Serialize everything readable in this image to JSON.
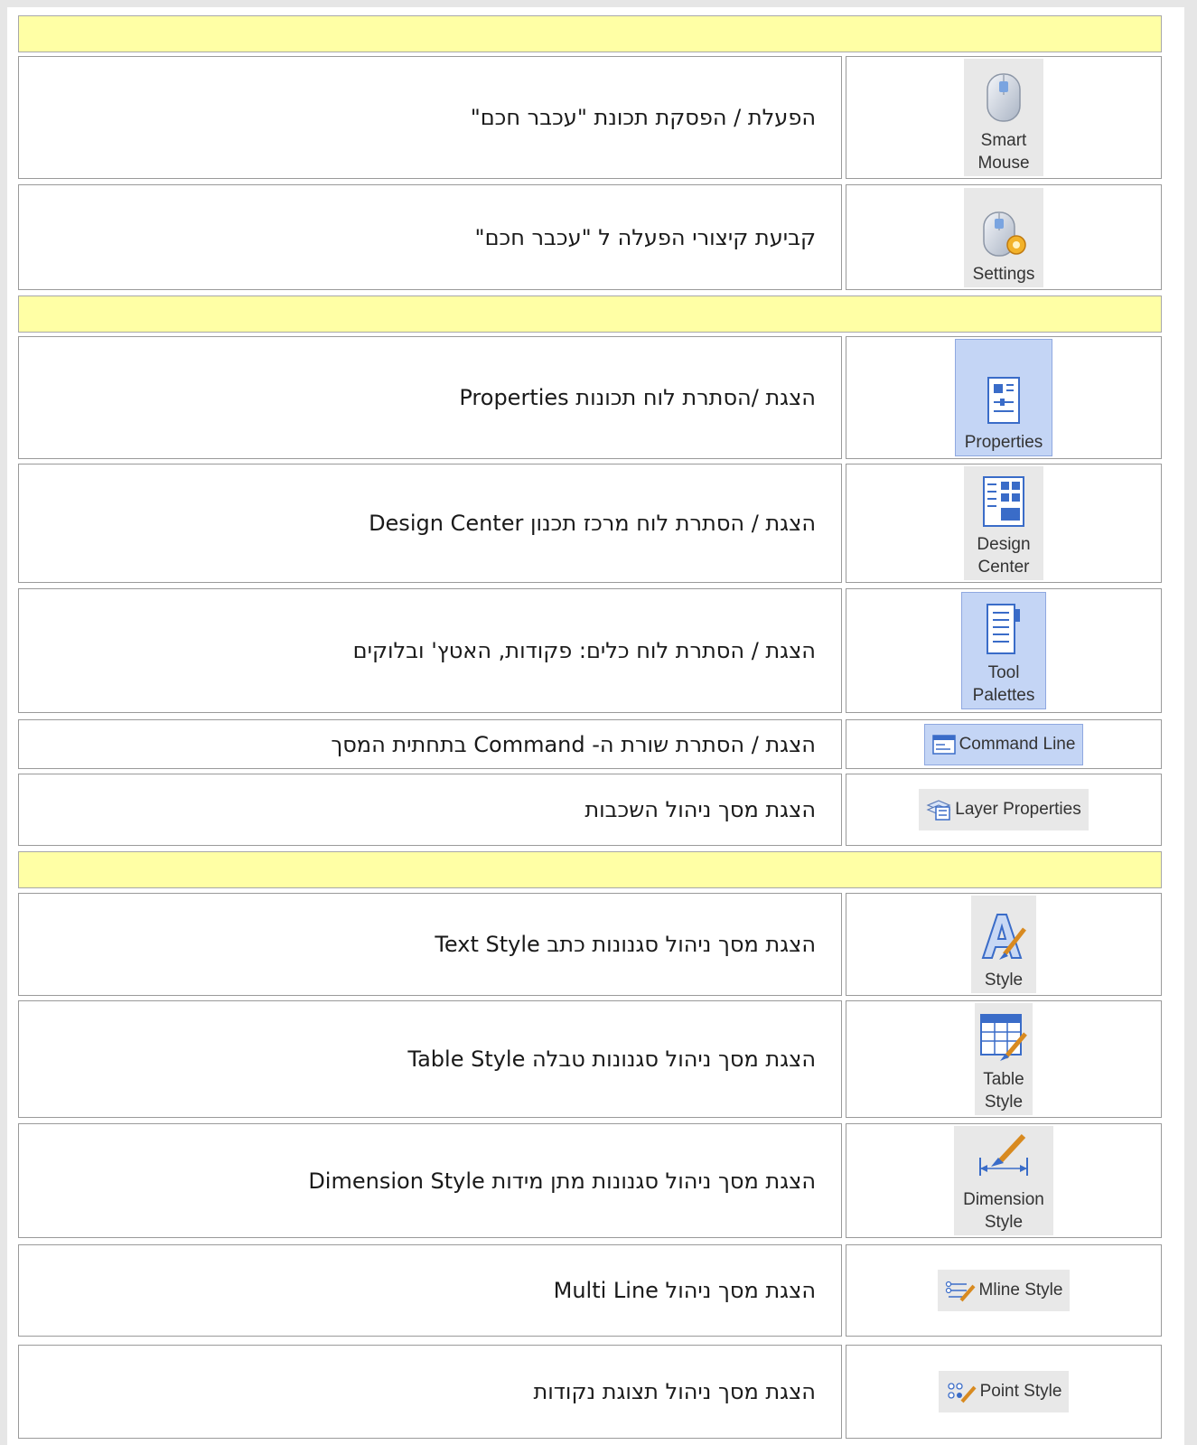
{
  "rows": [
    {
      "kind": "section"
    },
    {
      "kind": "item",
      "text": "הפעלת / הפסקת תכונת \"עכבר חכם\"",
      "icon": "smart-mouse-icon",
      "label": "Smart\nMouse"
    },
    {
      "kind": "item",
      "text": "קביעת קיצורי הפעלה ל \"עכבר חכם\"",
      "icon": "settings-icon",
      "label": "Settings"
    },
    {
      "kind": "section"
    },
    {
      "kind": "item",
      "text": "הצגת /הסתרת לוח תכונות Properties",
      "icon": "properties-icon",
      "label": "Properties"
    },
    {
      "kind": "item",
      "text": "הצגת / הסתרת לוח מרכז תכנון Design Center",
      "icon": "design-center-icon",
      "label": "Design\nCenter"
    },
    {
      "kind": "item",
      "text": "הצגת / הסתרת לוח כלים: פקודות, האטץ' ובלוקים",
      "icon": "tool-palettes-icon",
      "label": "Tool\nPalettes"
    },
    {
      "kind": "item",
      "text": "הצגת / הסתרת שורת ה- Command בתחתית המסך",
      "icon": "command-line-icon",
      "label": "Command Line"
    },
    {
      "kind": "item",
      "text": "הצגת מסך ניהול השכבות",
      "icon": "layer-properties-icon",
      "label": "Layer Properties"
    },
    {
      "kind": "section"
    },
    {
      "kind": "item",
      "text": "הצגת מסך ניהול סגנונות כתב Text Style",
      "icon": "text-style-icon",
      "label": "Style"
    },
    {
      "kind": "item",
      "text": "הצגת מסך ניהול סגנונות טבלה Table Style",
      "icon": "table-style-icon",
      "label": "Table\nStyle"
    },
    {
      "kind": "item",
      "text": "הצגת מסך ניהול סגנונות מתן מידות  Dimension Style",
      "icon": "dimension-style-icon",
      "label": "Dimension\nStyle"
    },
    {
      "kind": "item",
      "text": "הצגת מסך ניהול Multi Line",
      "icon": "mline-style-icon",
      "label": "Mline Style"
    },
    {
      "kind": "item",
      "text": "הצגת מסך ניהול תצוגת נקודות",
      "icon": "point-style-icon",
      "label": "Point Style"
    }
  ],
  "colors": {
    "section_fill": "#ffffa5",
    "selected_fill": "#c4d5f5",
    "tile_fill": "#e8e8e8"
  }
}
